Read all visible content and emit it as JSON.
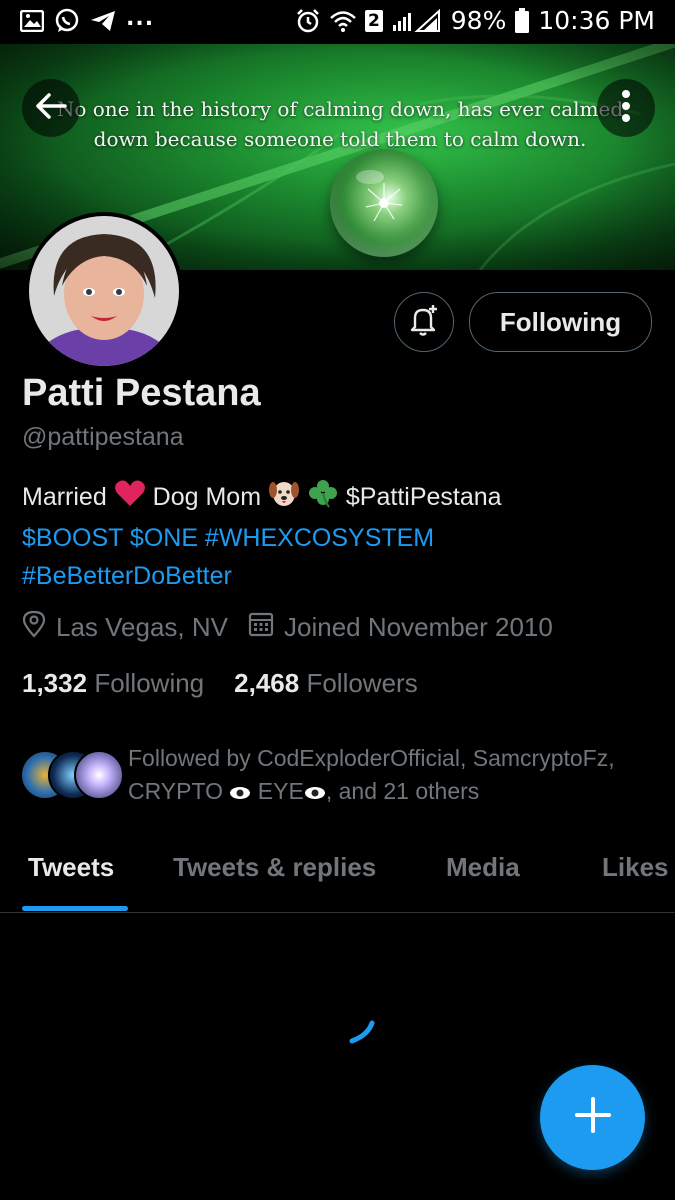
{
  "status_bar": {
    "overflow_dots": "...",
    "sim_badge": "2",
    "battery": "98%",
    "time": "10:36 PM"
  },
  "banner": {
    "quote": "No one in the history of calming down, has ever calmed down because someone told them to calm down."
  },
  "profile": {
    "name": "Patti Pestana",
    "handle": "@pattipestana",
    "follow_button": "Following",
    "bio": {
      "line1_a": "Married",
      "line1_b": "Dog Mom",
      "line1_cashtag": "$PattiPestana",
      "line2": "$BOOST $ONE #WHEXCOSYSTEM",
      "line3": "#BeBetterDoBetter"
    },
    "location": "Las Vegas, NV",
    "joined": "Joined November 2010",
    "following_count": "1,332",
    "following_label": "Following",
    "followers_count": "2,468",
    "followers_label": "Followers",
    "followed_by": "Followed by CodExploderOfficial, SamcryptoFz, CRYPTO",
    "followed_by_eye": "EYE",
    "followed_by_tail": ", and 21 others"
  },
  "tabs": [
    {
      "label": "Tweets",
      "active": true
    },
    {
      "label": "Tweets & replies",
      "active": false
    },
    {
      "label": "Media",
      "active": false
    },
    {
      "label": "Likes",
      "active": false
    }
  ],
  "colors": {
    "accent": "#1d9bf0",
    "background": "#000000",
    "muted_text": "#71767b"
  },
  "icons": [
    "gallery-icon",
    "whatsapp-icon",
    "telegram-icon",
    "alarm-icon",
    "wifi-icon",
    "signal-icon",
    "battery-icon",
    "back-arrow-icon",
    "more-vertical-icon",
    "bell-plus-icon",
    "location-pin-icon",
    "calendar-icon",
    "heart-emoji",
    "dog-emoji",
    "clover-emoji",
    "eye-emoji",
    "loading-spinner-icon",
    "plus-icon"
  ]
}
